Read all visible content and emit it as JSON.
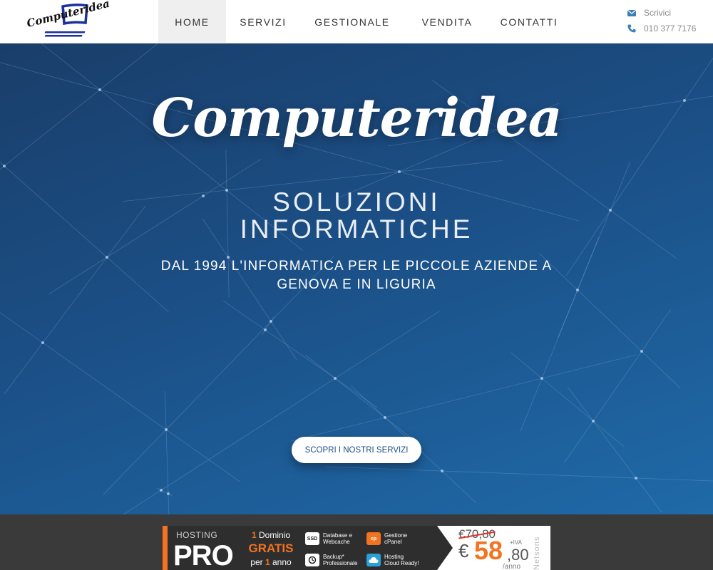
{
  "logo": {
    "text": "Computeridea",
    "name": "computeridea-logo"
  },
  "nav": {
    "items": [
      {
        "label": "HOME",
        "active": true
      },
      {
        "label": "SERVIZI",
        "active": false
      },
      {
        "label": "GESTIONALE",
        "active": false
      },
      {
        "label": "VENDITA",
        "active": false
      },
      {
        "label": "CONTATTI",
        "active": false
      }
    ]
  },
  "contact": {
    "email_label": "Scrivici",
    "phone": "010 377 7176",
    "icons": [
      "envelope-icon",
      "phone-icon"
    ]
  },
  "hero": {
    "title": "Computeridea",
    "subtitle_line1": "SOLUZIONI",
    "subtitle_line2": "INFORMATICHE",
    "tagline_line1": "DAL 1994 L'INFORMATICA PER LE PICCOLE AZIENDE A",
    "tagline_line2": "GENOVA E IN LIGURIA",
    "cta_label": "SCOPRI I NOSTRI SERVIZI"
  },
  "banner": {
    "hosting": "HOSTING",
    "pro": "PRO",
    "promo_num1": "1",
    "promo_line1": " Dominio",
    "promo_line2": "GRATIS",
    "promo_line3_pre": "per ",
    "promo_num3": "1",
    "promo_line3_post": " anno",
    "features": [
      {
        "icon": "SSD",
        "label_1": "Database e",
        "label_2": "Webcache"
      },
      {
        "icon": "backup-icon",
        "label_1": "Backup*",
        "label_2": "Professionale"
      },
      {
        "icon": "cp",
        "label_1": "Gestione",
        "label_2": "cPanel"
      },
      {
        "icon": "cloud-icon",
        "label_1": "Hosting",
        "label_2": "Cloud Ready!"
      }
    ],
    "price_old": "€70,80",
    "price_symbol": "€",
    "price_int": "58",
    "price_cents": ",80",
    "price_iva": "+IVA",
    "price_period": "/anno",
    "brand": "Netsons"
  },
  "colors": {
    "hero_dark": "#1a3e6a",
    "hero_light": "#1f6aa8",
    "accent_orange": "#f27321",
    "cta_text": "#1d4e84",
    "strip_bg": "#3a3a3a"
  }
}
